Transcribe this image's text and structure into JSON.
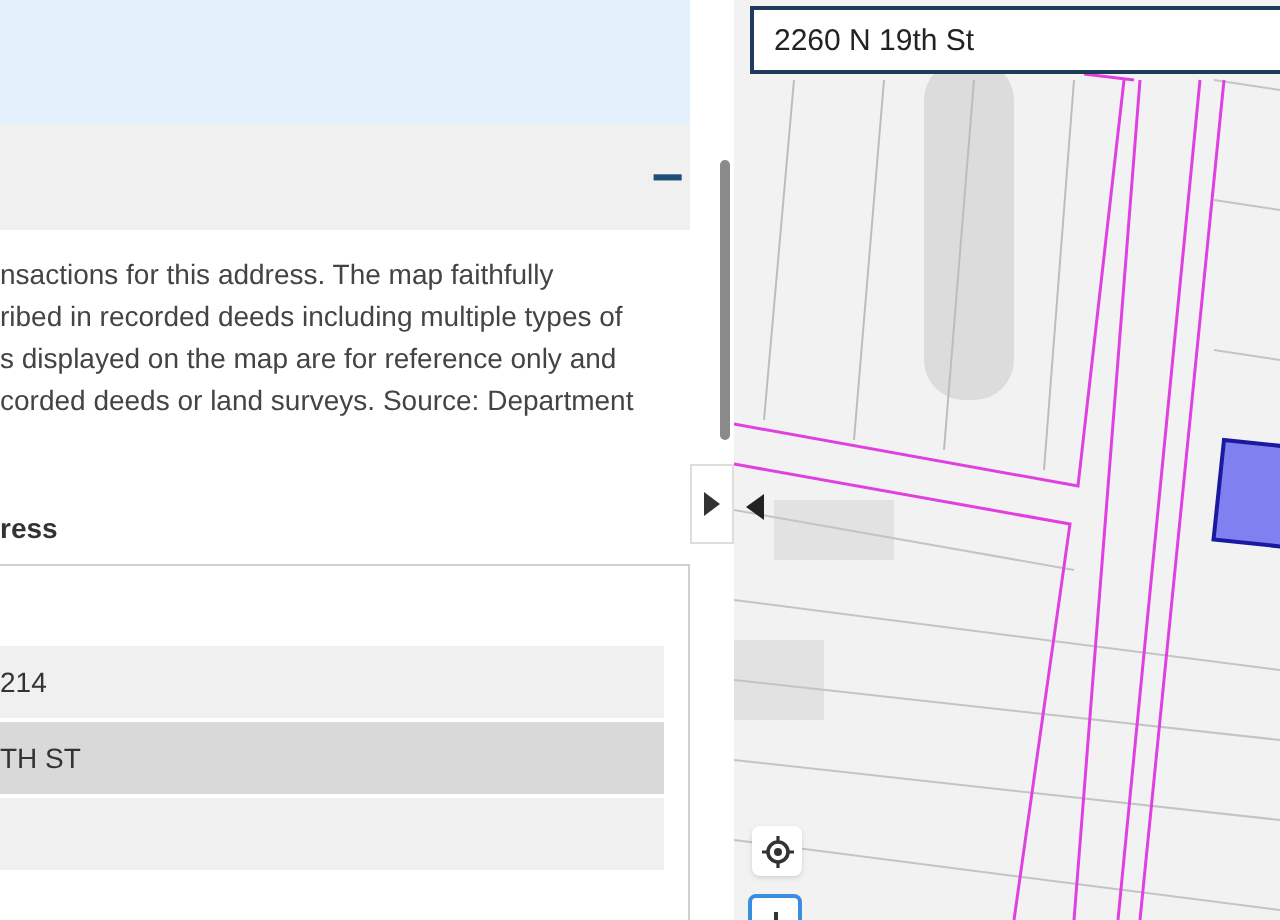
{
  "panel": {
    "collapse_symbol": "−",
    "description_lines": [
      "nsactions for this address. The map faithfully",
      "ribed in recorded deeds including multiple types of",
      "s displayed on the map are for reference only and",
      "corded deeds or land surveys. Source: Department"
    ],
    "heading": "ress",
    "rows": [
      {
        "text": "214",
        "selected": false
      },
      {
        "text": "TH ST",
        "selected": true
      },
      {
        "selected": false
      }
    ]
  },
  "map": {
    "kind": "picture",
    "search": {
      "value": "2260 N 19th St"
    }
  }
}
